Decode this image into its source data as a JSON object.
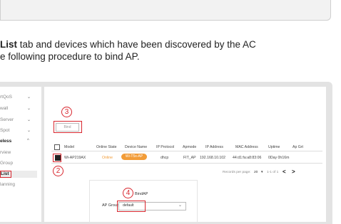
{
  "intro": {
    "line1_bold": "List",
    "line1_rest": " tab and devices which have been discovered by the AC",
    "line2": "e following procedure to bind AP."
  },
  "sidebar": {
    "items": [
      {
        "label": "rtQoS",
        "chevron": "⌄"
      },
      {
        "label": "wall",
        "chevron": "⌄"
      },
      {
        "label": " Server",
        "chevron": "⌄"
      },
      {
        "label": "Spot",
        "chevron": "⌄"
      },
      {
        "label": "eless",
        "chevron": "^"
      },
      {
        "label": "rview",
        "chevron": ""
      },
      {
        "label": "Group",
        "chevron": ""
      },
      {
        "label": "List",
        "chevron": ""
      },
      {
        "label": "lanning",
        "chevron": ""
      }
    ]
  },
  "steps": {
    "s2": "2",
    "s3": "3",
    "s4": "4"
  },
  "bind_button": "Bind",
  "table": {
    "headers": [
      "Model",
      "Online State",
      "Device Name",
      "IP Protocol",
      "Apmode",
      "IP Address",
      "MAC Address",
      "Uptime",
      "Ap Grt"
    ],
    "row": {
      "model": "Wi-AP219AX",
      "state": "Online",
      "name": "Wi-T5x-AP",
      "protocol": "dhcp",
      "apmode": "FIT_AP",
      "ip": "192.168.10.102",
      "mac": "44:d1:fa:a8:83:06",
      "uptime": "0Day 0h16m"
    }
  },
  "pager": {
    "records": "Records per page:",
    "count": "20",
    "range": "1-1 of 1",
    "prev": "<",
    "next": ">"
  },
  "dialog": {
    "title": "BindAP",
    "ap_group_label": "AP Group",
    "ap_group_value": "default"
  },
  "colors": {
    "highlight": "#d8262e",
    "online": "#f29c38"
  }
}
